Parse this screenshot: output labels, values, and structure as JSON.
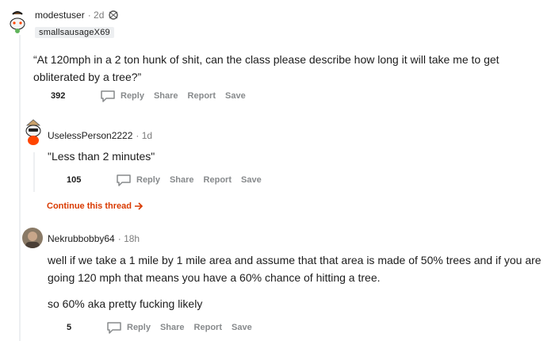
{
  "comments": [
    {
      "username": "modestuser",
      "time": "· 2d",
      "flair": "smallsausageX69",
      "body": "“At 120mph in a 2 ton hunk of shit, can the class please describe how long it will take me to get obliterated by a tree?”",
      "votes": "392",
      "actions": [
        "Reply",
        "Share",
        "Report",
        "Save"
      ]
    },
    {
      "username": "UselessPerson2222",
      "time": "· 1d",
      "body": "\"Less than 2 minutes\"",
      "votes": "105",
      "actions": [
        "Reply",
        "Share",
        "Report",
        "Save"
      ]
    },
    {
      "username": "Nekrubbobby64",
      "time": "· 18h",
      "body": "well if we take a 1 mile by 1 mile area and assume that that area is made of 50% trees and if you are going 120 mph that means you have a 60% chance of hitting a tree.",
      "body2": "so 60% aka pretty fucking likely",
      "votes": "5",
      "actions": [
        "Reply",
        "Share",
        "Report",
        "Save"
      ]
    }
  ],
  "continue_thread": "Continue this thread",
  "colors": {
    "accent": "#d93a00",
    "muted": "#878a8c",
    "thread": "#edeff1"
  },
  "icons": [
    "snoo-avatar-icon",
    "award-icon",
    "reply-icon",
    "arrow-right-icon",
    "user-photo-avatar"
  ]
}
